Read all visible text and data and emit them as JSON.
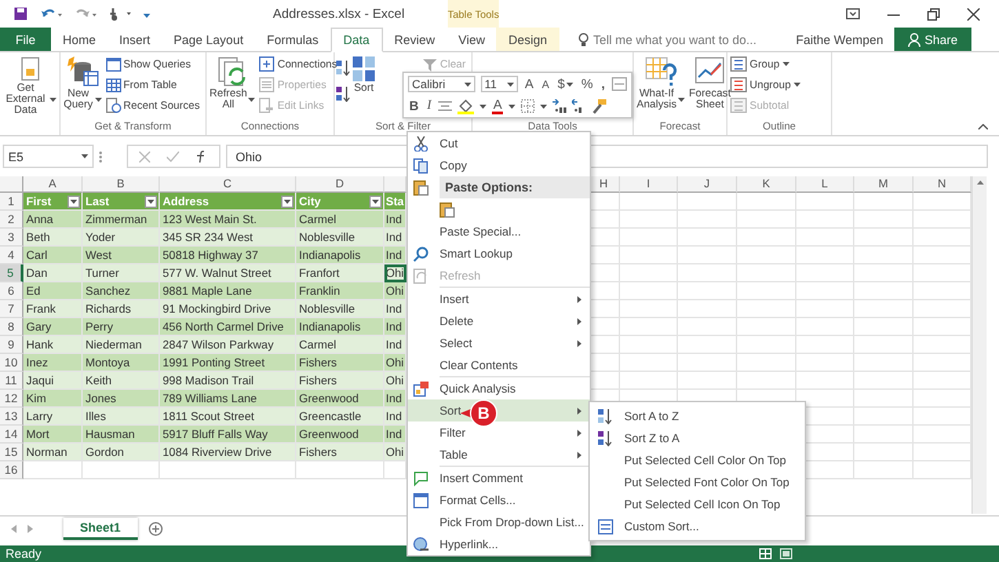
{
  "title_bar": {
    "title": "Addresses.xlsx - Excel",
    "context_label": "Table Tools"
  },
  "tabs": [
    {
      "label": "File",
      "kind": "file",
      "selected": false
    },
    {
      "label": "Home",
      "kind": "tab",
      "selected": false
    },
    {
      "label": "Insert",
      "kind": "tab",
      "selected": false
    },
    {
      "label": "Page Layout",
      "kind": "tab",
      "selected": false
    },
    {
      "label": "Formulas",
      "kind": "tab",
      "selected": false
    },
    {
      "label": "Data",
      "kind": "tab",
      "selected": true
    },
    {
      "label": "Review",
      "kind": "tab",
      "selected": false
    },
    {
      "label": "View",
      "kind": "tab",
      "selected": false
    },
    {
      "label": "Design",
      "kind": "contextual",
      "selected": false
    }
  ],
  "tell_me": {
    "placeholder": "Tell me what you want to do..."
  },
  "account": {
    "user": "Faithe Wempen",
    "share": "Share"
  },
  "ribbon": {
    "groups": [
      {
        "buttons": [
          {
            "kind": "large",
            "label": "Get External Data",
            "dropdown": true
          }
        ]
      },
      {
        "label": "Get & Transform",
        "buttons": [
          {
            "kind": "large",
            "label": "New Query",
            "dropdown": true
          },
          {
            "kind": "small",
            "label": "Show Queries",
            "disabled": false,
            "dropdown": false
          },
          {
            "kind": "small",
            "label": "From Table",
            "disabled": false,
            "dropdown": false
          },
          {
            "kind": "small",
            "label": "Recent Sources",
            "disabled": false,
            "dropdown": false
          }
        ]
      },
      {
        "label": "Connections",
        "buttons": [
          {
            "kind": "large",
            "label": "Refresh All",
            "dropdown": true
          },
          {
            "kind": "small",
            "label": "Connections",
            "disabled": false,
            "dropdown": false
          },
          {
            "kind": "small",
            "label": "Properties",
            "disabled": true,
            "dropdown": false
          },
          {
            "kind": "small",
            "label": "Edit Links",
            "disabled": true,
            "dropdown": false
          }
        ]
      },
      {
        "label": "Sort & Filter",
        "buttons": [
          {
            "kind": "sort-pair"
          },
          {
            "kind": "large",
            "label": "Sort",
            "dropdown": false
          },
          {
            "kind": "small",
            "label": "Clear",
            "disabled": true,
            "dropdown": false
          }
        ]
      },
      {
        "label": "Data Tools"
      },
      {
        "label": "Forecast",
        "buttons": [
          {
            "kind": "large",
            "label": "What-If Analysis",
            "dropdown": true
          },
          {
            "kind": "large",
            "label": "Forecast Sheet",
            "dropdown": false
          }
        ]
      },
      {
        "label": "Outline",
        "buttons": [
          {
            "kind": "small",
            "label": "Group",
            "disabled": false,
            "dropdown": true
          },
          {
            "kind": "small",
            "label": "Ungroup",
            "disabled": false,
            "dropdown": true
          },
          {
            "kind": "small",
            "label": "Subtotal",
            "disabled": true,
            "dropdown": false
          }
        ]
      }
    ]
  },
  "formula_bar": {
    "name_box": "E5",
    "formula": "Ohio"
  },
  "sheet": {
    "column_headers": [
      "A",
      "B",
      "C",
      "D",
      "H",
      "I",
      "J",
      "K",
      "L",
      "M",
      "N"
    ],
    "rows": [
      {
        "number": "1",
        "kind": "header",
        "selected": false,
        "cells": [
          "First",
          "Last",
          "Address",
          "City",
          "Sta"
        ]
      },
      {
        "number": "2",
        "kind": "data",
        "selected": false,
        "cells": [
          "Anna",
          "Zimmerman",
          "123 West Main St.",
          "Carmel",
          "Ind"
        ]
      },
      {
        "number": "3",
        "kind": "data",
        "selected": false,
        "cells": [
          "Beth",
          "Yoder",
          "345 SR 234 West",
          "Noblesville",
          "Ind"
        ]
      },
      {
        "number": "4",
        "kind": "data",
        "selected": false,
        "cells": [
          "Carl",
          "West",
          "50818 Highway 37",
          "Indianapolis",
          "Ind"
        ]
      },
      {
        "number": "5",
        "kind": "data",
        "selected": true,
        "cells": [
          "Dan",
          "Turner",
          "577 W. Walnut Street",
          "Franfort",
          "Ohi"
        ]
      },
      {
        "number": "6",
        "kind": "data",
        "selected": false,
        "cells": [
          "Ed",
          "Sanchez",
          "9881 Maple Lane",
          "Franklin",
          "Ohi"
        ]
      },
      {
        "number": "7",
        "kind": "data",
        "selected": false,
        "cells": [
          "Frank",
          "Richards",
          "91 Mockingbird Drive",
          "Noblesville",
          "Ind"
        ]
      },
      {
        "number": "8",
        "kind": "data",
        "selected": false,
        "cells": [
          "Gary",
          "Perry",
          "456 North Carmel Drive",
          "Indianapolis",
          "Ind"
        ]
      },
      {
        "number": "9",
        "kind": "data",
        "selected": false,
        "cells": [
          "Hank",
          "Niederman",
          "2847 Wilson Parkway",
          "Carmel",
          "Ind"
        ]
      },
      {
        "number": "10",
        "kind": "data",
        "selected": false,
        "cells": [
          "Inez",
          "Montoya",
          "1991 Ponting Street",
          "Fishers",
          "Ohi"
        ]
      },
      {
        "number": "11",
        "kind": "data",
        "selected": false,
        "cells": [
          "Jaqui",
          "Keith",
          "998 Madison Trail",
          "Fishers",
          "Ohi"
        ]
      },
      {
        "number": "12",
        "kind": "data",
        "selected": false,
        "cells": [
          "Kim",
          "Jones",
          "789 Williams Lane",
          "Greenwood",
          "Ind"
        ]
      },
      {
        "number": "13",
        "kind": "data",
        "selected": false,
        "cells": [
          "Larry",
          "Illes",
          "1811 Scout Street",
          "Greencastle",
          "Ind"
        ]
      },
      {
        "number": "14",
        "kind": "data",
        "selected": false,
        "cells": [
          "Mort",
          "Hausman",
          "5917 Bluff Falls Way",
          "Greenwood",
          "Ind"
        ]
      },
      {
        "number": "15",
        "kind": "data",
        "selected": false,
        "cells": [
          "Norman",
          "Gordon",
          "1084 Riverview Drive",
          "Fishers",
          "Ohi"
        ]
      },
      {
        "number": "16",
        "kind": "empty",
        "selected": false
      }
    ]
  },
  "mini_toolbar": {
    "row_1": [
      {
        "kind": "font",
        "value": "Calibri"
      },
      {
        "kind": "size",
        "value": "11"
      },
      {
        "kind": "grow",
        "label": "A"
      },
      {
        "kind": "shrink",
        "label": "A"
      },
      {
        "kind": "currency",
        "label": "$"
      },
      {
        "kind": "percent",
        "label": "%"
      },
      {
        "kind": "comma",
        "label": ","
      },
      {
        "kind": "merge"
      }
    ],
    "row_2": [
      {
        "kind": "bold",
        "label": "B"
      },
      {
        "kind": "italic",
        "label": "I"
      },
      {
        "kind": "align"
      },
      {
        "kind": "fill"
      },
      {
        "kind": "font-color",
        "label": "A"
      },
      {
        "kind": "borders"
      },
      {
        "kind": "inc-decimal"
      },
      {
        "kind": "dec-decimal"
      },
      {
        "kind": "painter"
      }
    ]
  },
  "context_menu": [
    {
      "kind": "cut",
      "label": "Cut",
      "selected": false,
      "disabled": false,
      "submenu": false
    },
    {
      "kind": "copy",
      "label": "Copy",
      "selected": false,
      "disabled": false,
      "submenu": false
    },
    {
      "kind": "header",
      "label": "Paste Options:"
    },
    {
      "kind": "paste"
    },
    {
      "kind": "plain",
      "label": "Paste Special...",
      "selected": false,
      "disabled": false,
      "submenu": false
    },
    {
      "kind": "lookup",
      "label": "Smart Lookup",
      "selected": false,
      "disabled": false,
      "submenu": false
    },
    {
      "kind": "refresh",
      "label": "Refresh",
      "selected": false,
      "disabled": true,
      "submenu": false
    },
    {
      "kind": "separator"
    },
    {
      "kind": "plain",
      "label": "Insert",
      "selected": false,
      "disabled": false,
      "submenu": true
    },
    {
      "kind": "plain",
      "label": "Delete",
      "selected": false,
      "disabled": false,
      "submenu": true
    },
    {
      "kind": "plain",
      "label": "Select",
      "selected": false,
      "disabled": false,
      "submenu": true
    },
    {
      "kind": "plain",
      "label": "Clear Contents",
      "selected": false,
      "disabled": false,
      "submenu": false
    },
    {
      "kind": "separator"
    },
    {
      "kind": "analysis",
      "label": "Quick Analysis",
      "selected": false,
      "disabled": false,
      "submenu": false
    },
    {
      "kind": "plain",
      "label": "Sort",
      "selected": true,
      "disabled": false,
      "submenu": true
    },
    {
      "kind": "plain",
      "label": "Filter",
      "selected": false,
      "disabled": false,
      "submenu": true
    },
    {
      "kind": "plain",
      "label": "Table",
      "selected": false,
      "disabled": false,
      "submenu": true
    },
    {
      "kind": "separator"
    },
    {
      "kind": "comment",
      "label": "Insert Comment",
      "selected": false,
      "disabled": false,
      "submenu": false
    },
    {
      "kind": "format",
      "label": "Format Cells...",
      "selected": false,
      "disabled": false,
      "submenu": false
    },
    {
      "kind": "plain",
      "label": "Pick From Drop-down List...",
      "selected": false,
      "disabled": false,
      "submenu": false
    },
    {
      "kind": "link",
      "label": "Hyperlink...",
      "selected": false,
      "disabled": false,
      "submenu": false
    }
  ],
  "submenu": [
    {
      "kind": "sort-az",
      "label": "Sort A to Z"
    },
    {
      "kind": "sort-za",
      "label": "Sort Z to A"
    },
    {
      "kind": "plain",
      "label": "Put Selected Cell Color On Top"
    },
    {
      "kind": "plain",
      "label": "Put Selected Font Color On Top"
    },
    {
      "kind": "plain",
      "label": "Put Selected Cell Icon On Top"
    },
    {
      "kind": "custom",
      "label": "Custom Sort..."
    }
  ],
  "callout": {
    "label": "B"
  },
  "sheet_tabs": [
    {
      "label": "Sheet1",
      "selected": true
    }
  ],
  "status_bar": {
    "text": "Ready"
  }
}
